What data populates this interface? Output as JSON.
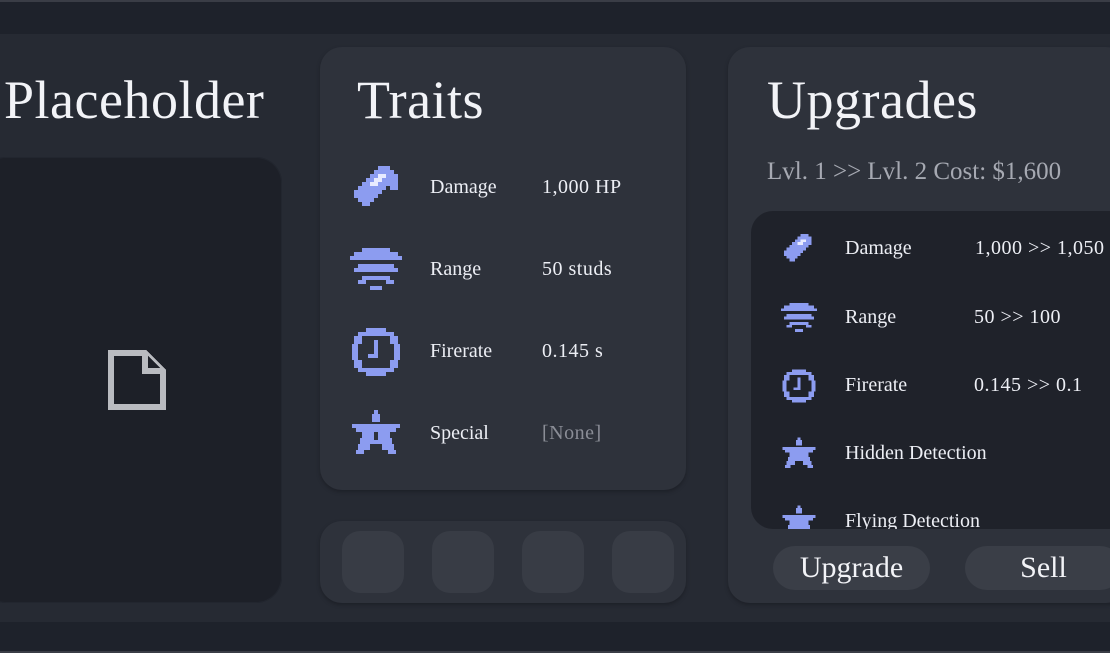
{
  "colors": {
    "accent_icon": "#8c9cf0",
    "background": "#262a33",
    "card": "#2e323b",
    "inset": "#1f222a"
  },
  "left": {
    "title": "Placeholder",
    "image_icon": "file-icon"
  },
  "traits": {
    "title": "Traits",
    "rows": [
      {
        "icon": "damage-icon",
        "label": "Damage",
        "value": "1,000 HP"
      },
      {
        "icon": "range-icon",
        "label": "Range",
        "value": "50 studs"
      },
      {
        "icon": "firerate-icon",
        "label": "Firerate",
        "value": "0.145 s"
      },
      {
        "icon": "special-icon",
        "label": "Special",
        "value": "[None]"
      }
    ],
    "slots": 4
  },
  "upgrades": {
    "title": "Upgrades",
    "level_line": "Lvl. 1 >> Lvl. 2   Cost: $1,600",
    "rows": [
      {
        "icon": "damage-icon",
        "label": "Damage",
        "value": "1,000 >> 1,050"
      },
      {
        "icon": "range-icon",
        "label": "Range",
        "value": "50 >> 100"
      },
      {
        "icon": "firerate-icon",
        "label": "Firerate",
        "value": "0.145 >> 0.1"
      },
      {
        "icon": "special-icon",
        "label": "Hidden Detection",
        "value": ""
      },
      {
        "icon": "special-icon",
        "label": "Flying Detection",
        "value": ""
      }
    ],
    "upgrade_label": "Upgrade",
    "sell_label": "Sell"
  }
}
